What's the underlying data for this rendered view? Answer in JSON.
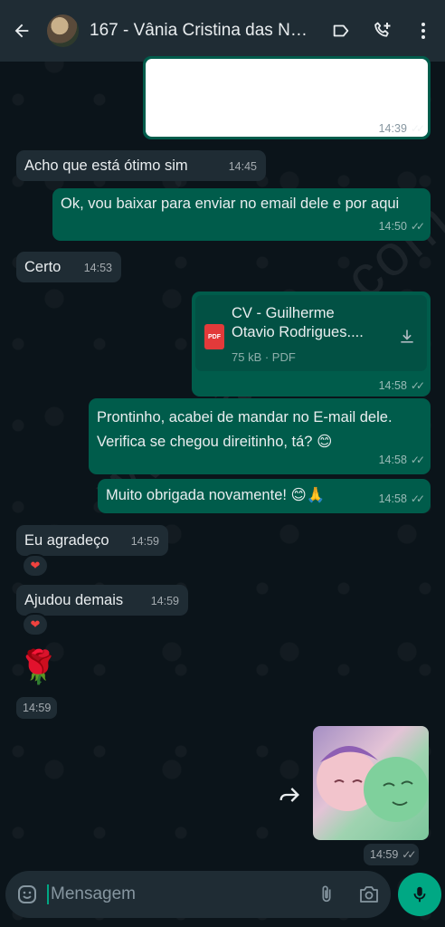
{
  "header": {
    "title": "167 - Vânia Cristina das Ne...",
    "icons": [
      "arrow-back-icon",
      "label-icon",
      "add-call-icon",
      "more-vert-icon"
    ]
  },
  "watermark": "www.aokim.com",
  "messages": [
    {
      "id": "m0",
      "dir": "out",
      "type": "image",
      "time": "14:39"
    },
    {
      "id": "m1",
      "dir": "in",
      "text": "Acho que está ótimo sim",
      "time": "14:45"
    },
    {
      "id": "m2",
      "dir": "out",
      "text": "Ok, vou baixar para enviar no email dele e por aqui",
      "time": "14:50"
    },
    {
      "id": "m3",
      "dir": "in",
      "text": "Certo",
      "time": "14:53"
    },
    {
      "id": "m4",
      "dir": "out",
      "type": "document",
      "file_line1": "CV - Guilherme",
      "file_line2": "Otavio Rodrigues....",
      "file_icon_label": "PDF",
      "file_meta": "75 kB · PDF",
      "time": "14:58"
    },
    {
      "id": "m5",
      "dir": "out",
      "text": "Prontinho, acabei de mandar no E-mail dele. Verifica se chegou direitinho, tá? 😊",
      "time": "14:58"
    },
    {
      "id": "m6",
      "dir": "out",
      "text": "Muito obrigada novamente! 😊🙏",
      "time": "14:58"
    },
    {
      "id": "m7",
      "dir": "in",
      "text": "Eu agradeço",
      "time": "14:59",
      "reaction": "❤"
    },
    {
      "id": "m8",
      "dir": "in",
      "text": "Ajudou demais",
      "time": "14:59",
      "reaction": "❤"
    },
    {
      "id": "m9",
      "dir": "in",
      "type": "emoji",
      "text": "🌹",
      "time": "14:59"
    },
    {
      "id": "m10",
      "dir": "out",
      "type": "sticker",
      "time": "14:59"
    }
  ],
  "input": {
    "placeholder": "Mensagem"
  },
  "colors": {
    "header_bg": "#1f2c34",
    "incoming": "#1f2c34",
    "outgoing": "#005c4b",
    "accent": "#00a884",
    "background": "#0b141a"
  }
}
